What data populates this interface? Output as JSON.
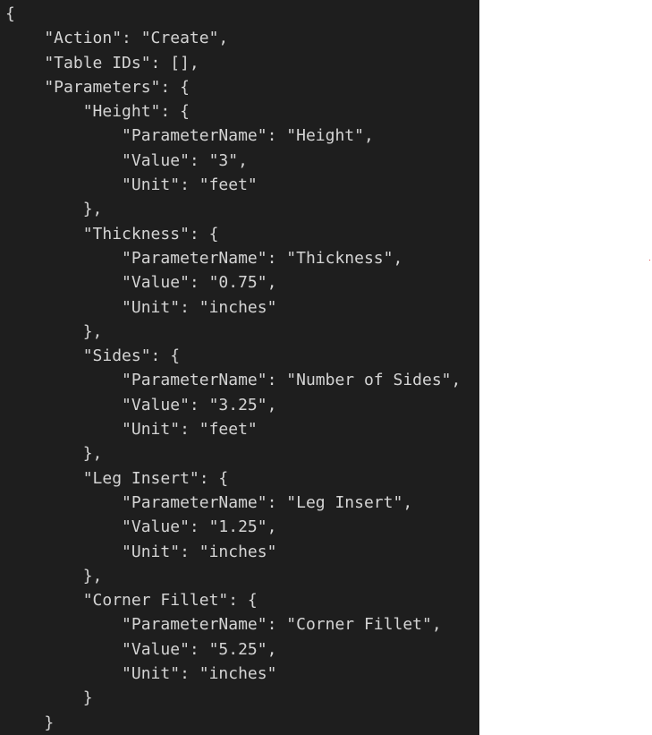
{
  "editor": {
    "lines": [
      "{",
      "    \"Action\": \"Create\",",
      "    \"Table IDs\": [],",
      "    \"Parameters\": {",
      "        \"Height\": {",
      "            \"ParameterName\": \"Height\",",
      "            \"Value\": \"3\",",
      "            \"Unit\": \"feet\"",
      "        },",
      "        \"Thickness\": {",
      "            \"ParameterName\": \"Thickness\",",
      "            \"Value\": \"0.75\",",
      "            \"Unit\": \"inches\"",
      "        },",
      "        \"Sides\": {",
      "            \"ParameterName\": \"Number of Sides\",",
      "            \"Value\": \"3.25\",",
      "            \"Unit\": \"feet\"",
      "        },",
      "        \"Leg Insert\": {",
      "            \"ParameterName\": \"Leg Insert\",",
      "            \"Value\": \"1.25\",",
      "            \"Unit\": \"inches\"",
      "        },",
      "        \"Corner Fillet\": {",
      "            \"ParameterName\": \"Corner Fillet\",",
      "            \"Value\": \"5.25\",",
      "            \"Unit\": \"inches\"",
      "        }",
      "    }"
    ]
  },
  "colors": {
    "editor_background": "#1e1e1e",
    "text": "#d4d4d4",
    "page_background": "#ffffff",
    "marker_dot": "#e05050"
  }
}
